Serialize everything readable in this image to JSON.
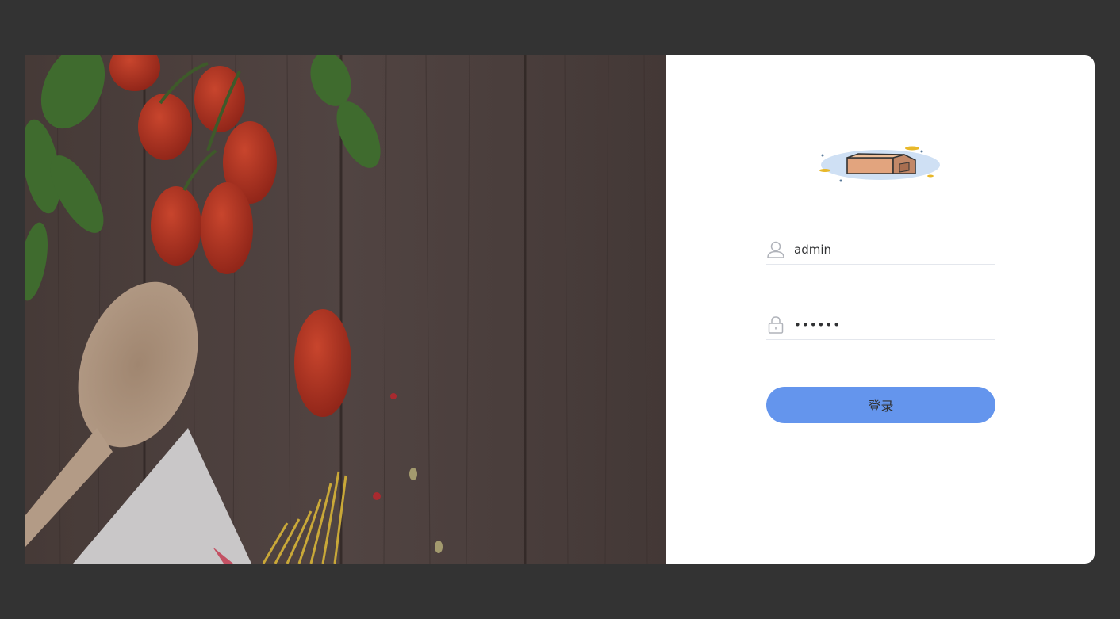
{
  "login": {
    "logo_icon": "package-box-icon",
    "username": {
      "icon": "user-icon",
      "value": "admin"
    },
    "password": {
      "icon": "lock-icon",
      "value": "••••••"
    },
    "submit_label": "登录"
  },
  "background": {
    "image": "food-on-wooden-table",
    "color_page": "#333333",
    "color_button": "#6495ed"
  }
}
